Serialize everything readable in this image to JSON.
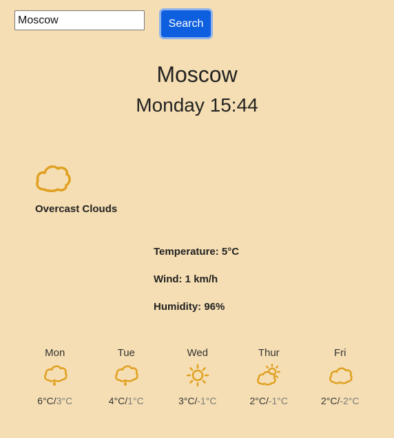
{
  "search": {
    "value": "Moscow",
    "button_label": "Search"
  },
  "current": {
    "city": "Moscow",
    "datetime": "Monday 15:44",
    "icon": "overcast-clouds-icon",
    "description": "Overcast Clouds",
    "temperature": "Temperature: 5°C",
    "wind": "Wind: 1 km/h",
    "humidity": "Humidity: 96%"
  },
  "forecast": [
    {
      "day": "Mon",
      "icon": "rain-cloud-icon",
      "high": "6°C",
      "low": "3°C"
    },
    {
      "day": "Tue",
      "icon": "rain-cloud-icon",
      "high": "4°C",
      "low": "1°C"
    },
    {
      "day": "Wed",
      "icon": "sun-icon",
      "high": "3°C",
      "low": "-1°C"
    },
    {
      "day": "Thur",
      "icon": "partly-cloudy-icon",
      "high": "2°C",
      "low": "-1°C"
    },
    {
      "day": "Fri",
      "icon": "cloud-icon",
      "high": "2°C",
      "low": "-2°C"
    }
  ],
  "colors": {
    "background": "#f5deb3",
    "icon": "#e0a020",
    "button": "#0d5fe0",
    "text": "#222222",
    "low_temp": "#7a7a7a"
  },
  "separator": "/"
}
